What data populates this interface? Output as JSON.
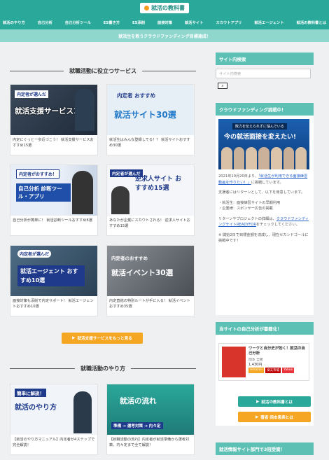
{
  "logo": {
    "title": "就活の教科書"
  },
  "nav": [
    "就活のやり方",
    "自己分析",
    "自己分析ツール",
    "ES書き方",
    "ES添削",
    "面接対策",
    "就活サイト",
    "スカウトアプリ",
    "就活エージェント",
    "就活の教科書とは"
  ],
  "banner": "就活生を救うクラウドファンディング目標達成！",
  "section1": {
    "title": "就職活動に役立つサービス"
  },
  "cards": [
    {
      "thumb_sub": "内定者が選んだ",
      "thumb_main": "就活支援サービス15",
      "caption": "内定にぐっと一歩近づこう！ 就活支援サービスおすすめ15選"
    },
    {
      "thumb_sub": "内定者 おすすめ",
      "thumb_main": "就活サイト30選",
      "caption": "就活生はみんな登録してる！？ 就活サイトおすすめ30選"
    },
    {
      "thumb_sub": "内定者がおすすめ！",
      "thumb_main": "自己分析 診断ツール・アプリ",
      "caption": "自己分析が簡単に！ 就活診断ツールおすすめ8選"
    },
    {
      "thumb_sub": "内定者が選んだ",
      "thumb_main": "逆求人サイト おすすめ15選",
      "caption": "あなたが企業にスカウトされる！ 逆求人サイトおすすめ15選"
    },
    {
      "thumb_sub": "内定者が選んだ",
      "thumb_main": "就活エージェント おすすめ10選",
      "caption": "面接対策も添削で内定サポート！ 就活エージェントおすすめ10選"
    },
    {
      "thumb_sub": "内定者のおすすめ",
      "thumb_main": "就活イベント30選",
      "caption": "内定直結の特別ルートが手に入る！ 就活イベントおすすめ35選"
    }
  ],
  "more_button": "就活支援サービスをもっと見る",
  "section2": {
    "title": "就職活動のやり方"
  },
  "cards2": [
    {
      "thumb_sub": "簡単に解説！",
      "thumb_main": "就活のやり方",
      "caption": "【就活のやり方マニュアル】内定者が4ステップで完全解説！"
    },
    {
      "thumb_sub": "準備 → 選考対策 → 内々定",
      "thumb_main": "就活の流れ",
      "caption": "【就職活動の流れ】内定者が就活準備から選考対策、内々定まで全て解説！"
    }
  ],
  "sidebar": {
    "search_header": "サイト内検索",
    "search_placeholder": "サイト内検索",
    "search_icon": "search-icon",
    "crowd_header": "クラウドファンディング挑戦中！",
    "crowd_image_top": "敗力を伝えられずに悩んでいる",
    "crowd_image_main": "今の就活面接を変えたい!",
    "crowd_text1a": "2021年10月20日より、",
    "crowd_text1b": "「就活生が利用できる面接練習動画を作りたい！」",
    "crowd_text1c": "に挑戦しています。",
    "crowd_text2": "支援者にはリターンとして、以下を用意しています。",
    "crowd_list": [
      "・就活生：面接練習サイトの早期利用",
      "・企業様：スポンサー広告の掲載"
    ],
    "crowd_text3a": "リターンやプロジェクトの詳細は、",
    "crowd_text3b": "クラウドファンディングサイトREADYFOR",
    "crowd_text3c": "をチェックしてください。",
    "crowd_text4": "※ 開始2日で目標金額を達成し、現在セカンドゴールに挑戦中です！",
    "book_header": "当サイトの自己分析が書籍化！",
    "book_title": "ワークと自分史が効く！就活の自己分析",
    "book_author": "岡本 全勝",
    "book_price": "1,430円",
    "book_shops": [
      "Amazon",
      "楽天市場",
      "Yahoo"
    ],
    "btn_about": "就活の教科書とは",
    "btn_author": "著者 岡本恵典とは",
    "section_header": "就活情報サイト部門で3冠受賞！"
  },
  "colors": {
    "teal": "#2aa89a",
    "teal_light": "#5cc0b4",
    "orange": "#f5a623",
    "green_btn": "#2aa89a"
  }
}
